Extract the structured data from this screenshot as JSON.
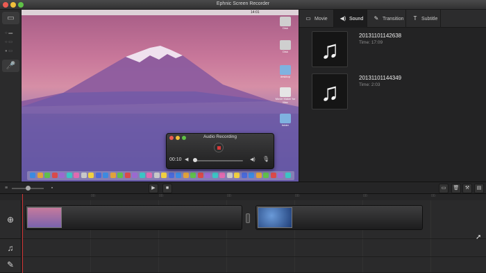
{
  "window": {
    "title": "Ephnic Screen Recorder"
  },
  "tabs": [
    {
      "label": "Movie",
      "icon": "film-icon",
      "active": false
    },
    {
      "label": "Sound",
      "icon": "speaker-icon",
      "active": true
    },
    {
      "label": "Transition",
      "icon": "wand-icon",
      "active": false
    },
    {
      "label": "Subtitle",
      "icon": "text-t-icon",
      "active": false
    }
  ],
  "media": [
    {
      "name": "20131101142638",
      "time": "Time: 17:09",
      "icon": "music-note-icon"
    },
    {
      "name": "20131101144349",
      "time": "Time: 2:03",
      "icon": "music-note-icon"
    }
  ],
  "audio_recording": {
    "title": "Audio Recording",
    "elapsed": "00:10"
  },
  "desktop": {
    "menubar_time": "14:01",
    "icons": [
      "Disk",
      "Disk",
      "desktop",
      "Movie Maker for Mac",
      "folder"
    ]
  },
  "ruler": [
    "00:",
    "00:",
    "00:",
    "00:",
    "00:",
    "00:",
    "00:"
  ],
  "colors": {
    "accent_red": "#d13333",
    "record": "#d93a3a"
  }
}
